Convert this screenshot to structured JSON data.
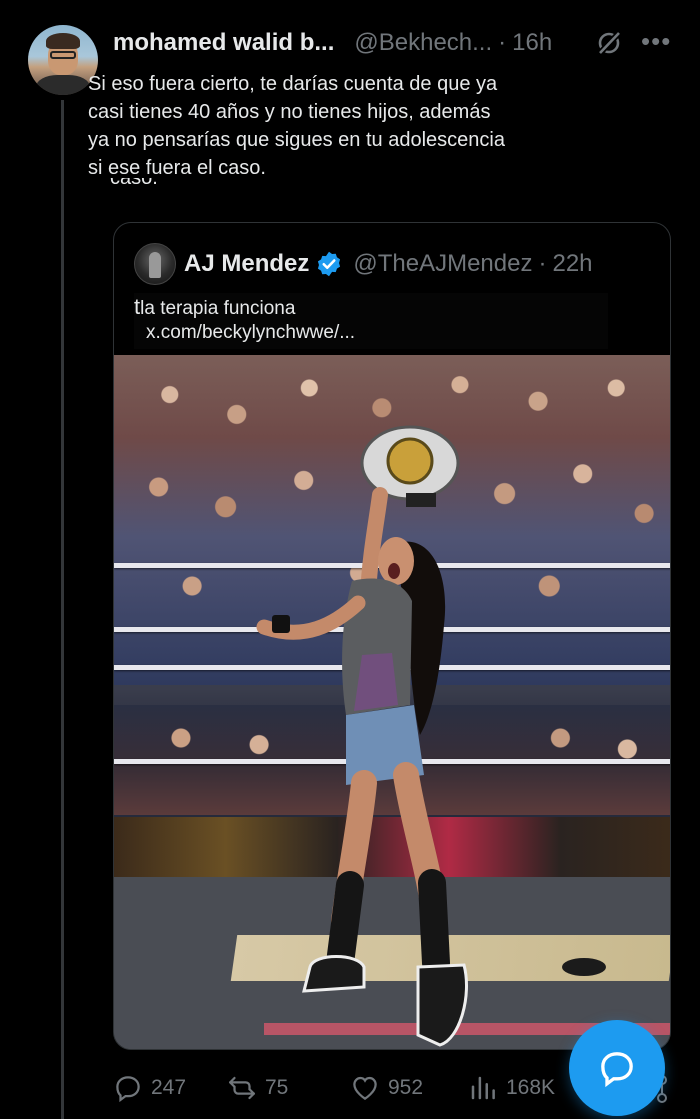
{
  "reply": {
    "display_name": "mohamed walid b...",
    "handle": "@Bekhech...",
    "separator": "·",
    "time": "16h",
    "text": "Si eso fuera cierto, te darías cuenta de que ya\ncasi tienes 40 años y no tienes hijos, además\nya no pensarías que sigues en tu adolescencia\nsi ese fuera el caso.",
    "text_ghost": "caso."
  },
  "quote": {
    "display_name": "AJ Mendez",
    "handle": "@TheAJMendez",
    "separator": "·",
    "time": "22h",
    "text_glyph": "t",
    "text": "la terapia funciona",
    "link": "x.com/beckylynchwwe/..."
  },
  "actions": {
    "replies": "247",
    "reposts": "75",
    "likes": "952",
    "views": "168K"
  },
  "icons": {
    "grok": "grok-icon",
    "more": "more-icon",
    "verified": "verified-badge-icon",
    "reply": "reply-icon",
    "repost": "repost-icon",
    "like": "heart-icon",
    "views": "views-icon",
    "compose": "compose-reply-icon"
  },
  "colors": {
    "background": "#000000",
    "text": "#e7e9ea",
    "muted": "#71767b",
    "border": "#2f3336",
    "accent": "#1d9bf0"
  }
}
